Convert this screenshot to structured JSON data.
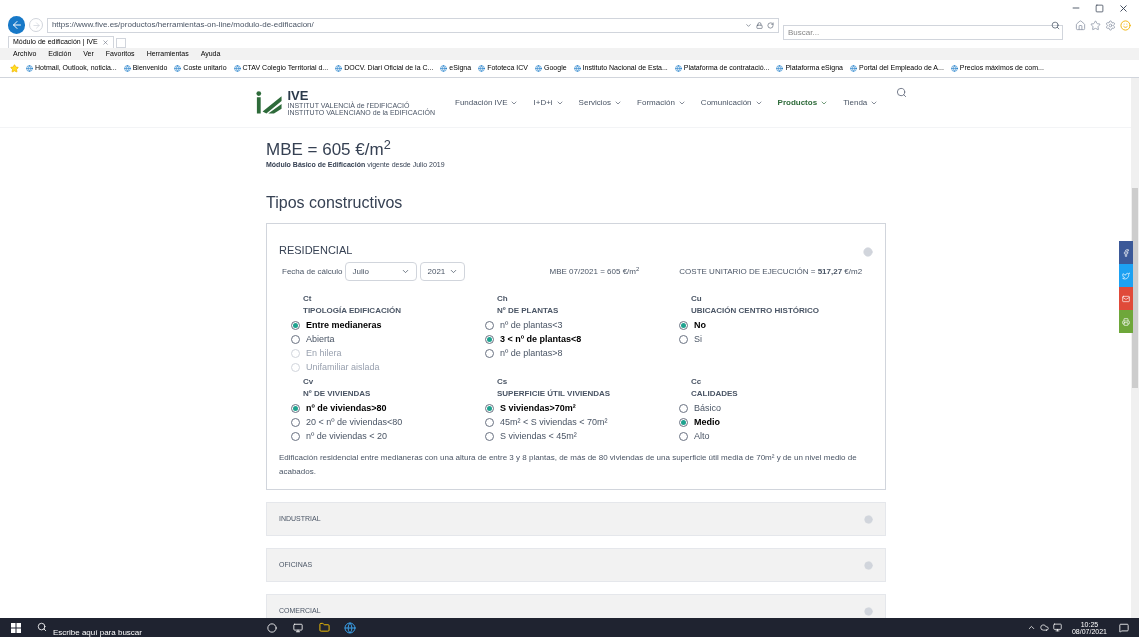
{
  "browser": {
    "url": "https://www.five.es/productos/herramientas-on-line/modulo-de-edificacion/",
    "search": {
      "placeholder": "Buscar..."
    },
    "tab": {
      "title": "Módulo de edificación | IVE"
    },
    "menu": [
      "Archivo",
      "Edición",
      "Ver",
      "Favoritos",
      "Herramientas",
      "Ayuda"
    ],
    "favorites": [
      "Hotmail, Outlook, noticia...",
      "Bienvenido",
      "Coste unitario",
      "CTAV Colegio Territorial d...",
      "DOCV. Diari Oficial de la C...",
      "eSigna",
      "Fototeca ICV",
      "Google",
      "Instituto Nacional de Esta...",
      "Plataforma de contratació...",
      "Plataforma eSigna",
      "Portal del Empleado de A...",
      "Precios máximos de com..."
    ]
  },
  "site": {
    "logo": {
      "name": "IVE",
      "line1": "INSTITUT VALENCIÀ de l'EDIFICACIÓ",
      "line2": "INSTITUTO VALENCIANO de la EDIFICACIÓN"
    },
    "nav": [
      {
        "label": "Fundación IVE",
        "selected": false
      },
      {
        "label": "I+D+i",
        "selected": false
      },
      {
        "label": "Servicios",
        "selected": false
      },
      {
        "label": "Formación",
        "selected": false
      },
      {
        "label": "Comunicación",
        "selected": false
      },
      {
        "label": "Productos",
        "selected": true
      },
      {
        "label": "Tienda",
        "selected": false
      }
    ]
  },
  "mbe": {
    "title": "MBE = 605 €/m$^{2}$",
    "subtitle": "**Módulo Básico de Edificación** vigente desde Julio 2019"
  },
  "heading": "Tipos constructivos",
  "residencial": {
    "title": "RESIDENCIAL",
    "date_label": "Fecha de cálculo",
    "month": "Julio",
    "year": "2021",
    "mbe_value": "MBE 07/2021 = 605 €/m$^{2}$",
    "coste": "COSTE UNITARIO DE EJECUCIÓN = **517,27** €/m2",
    "groups": [
      {
        "code": "Ct",
        "title": "TIPOLOGÍA EDIFICACIÓN",
        "options": [
          {
            "label": "Entre medianeras",
            "selected": true,
            "disabled": false
          },
          {
            "label": "Abierta",
            "selected": false,
            "disabled": false
          },
          {
            "label": "En hilera",
            "selected": false,
            "disabled": true
          },
          {
            "label": "Unifamiliar aislada",
            "selected": false,
            "disabled": true
          }
        ]
      },
      {
        "code": "Ch",
        "title": "Nº DE PLANTAS",
        "options": [
          {
            "label": "nº de plantas<3",
            "selected": false,
            "disabled": false
          },
          {
            "label": "3 < nº de plantas<8",
            "selected": true,
            "disabled": false
          },
          {
            "label": "nº de plantas>8",
            "selected": false,
            "disabled": false
          }
        ]
      },
      {
        "code": "Cu",
        "title": "UBICACIÓN CENTRO HISTÓRICO",
        "options": [
          {
            "label": "No",
            "selected": true,
            "disabled": false
          },
          {
            "label": "Si",
            "selected": false,
            "disabled": false
          }
        ]
      },
      {
        "code": "Cv",
        "title": "Nº DE VIVIENDAS",
        "options": [
          {
            "label": "nº de viviendas>80",
            "selected": true,
            "disabled": false
          },
          {
            "label": "20 < nº de viviendas<80",
            "selected": false,
            "disabled": false
          },
          {
            "label": "nº de viviendas < 20",
            "selected": false,
            "disabled": false
          }
        ]
      },
      {
        "code": "Cs",
        "title": "SUPERFICIE ÚTIL VIVIENDAS",
        "options": [
          {
            "label": "S viviendas>70m²",
            "selected": true,
            "disabled": false
          },
          {
            "label": "45m² < S viviendas < 70m²",
            "selected": false,
            "disabled": false
          },
          {
            "label": "S viviendas < 45m²",
            "selected": false,
            "disabled": false
          }
        ]
      },
      {
        "code": "Cc",
        "title": "CALIDADES",
        "options": [
          {
            "label": "Básico",
            "selected": false,
            "disabled": false
          },
          {
            "label": "Medio",
            "selected": true,
            "disabled": false
          },
          {
            "label": "Alto",
            "selected": false,
            "disabled": false
          }
        ]
      }
    ],
    "description": "Edificación residencial entre medianeras con una altura de entre 3 y 8 plantas, de más de 80 viviendas de una superficie útil media de 70m² y de un nivel medio de acabados."
  },
  "sections": [
    "INDUSTRIAL",
    "OFICINAS",
    "COMERCIAL"
  ],
  "taskbar": {
    "search": {
      "placeholder": "Escribe aquí para buscar"
    },
    "time": "10:25",
    "date": "08/07/2021"
  }
}
